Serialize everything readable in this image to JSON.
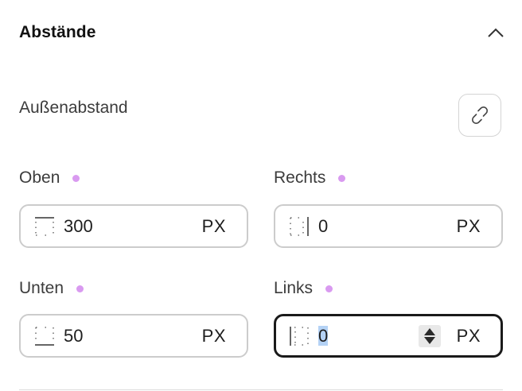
{
  "section": {
    "title": "Abstände",
    "collapse_icon": "chevron-up-icon"
  },
  "margin": {
    "label": "Außenabstand",
    "link_icon": "link-icon"
  },
  "fields": {
    "top": {
      "label": "Oben",
      "value": "300",
      "unit": "PX",
      "icon": "margin-top-icon"
    },
    "right": {
      "label": "Rechts",
      "value": "0",
      "unit": "PX",
      "icon": "margin-right-icon"
    },
    "bottom": {
      "label": "Unten",
      "value": "50",
      "unit": "PX",
      "icon": "margin-bottom-icon"
    },
    "left": {
      "label": "Links",
      "value": "0",
      "unit": "PX",
      "icon": "margin-left-icon",
      "focused": true
    }
  },
  "colors": {
    "indicator_dot": "#d99af0",
    "focus_border": "#1a1a1a",
    "selection": "#b4d2f5"
  }
}
